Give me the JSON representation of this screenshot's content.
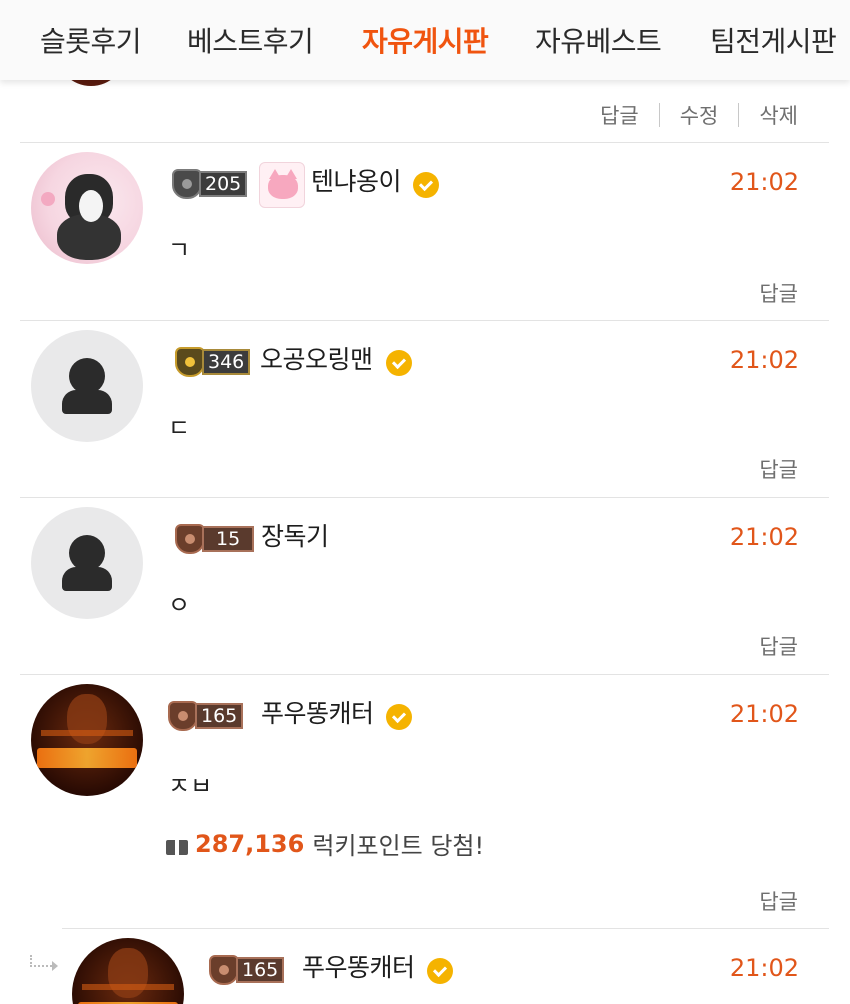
{
  "nav": {
    "tabs": [
      {
        "label": "슬롯후기",
        "active": false
      },
      {
        "label": "베스트후기",
        "active": false
      },
      {
        "label": "자유게시판",
        "active": true
      },
      {
        "label": "자유베스트",
        "active": false
      },
      {
        "label": "팀전게시판",
        "active": false
      }
    ]
  },
  "top_actions": {
    "reply": "답글",
    "edit": "수정",
    "delete": "삭제"
  },
  "comments": [
    {
      "level": "205",
      "username": "텐냐옹이",
      "time": "21:02",
      "text": "ㄱ",
      "reply": "답글"
    },
    {
      "level": "346",
      "username": "오공오링맨",
      "time": "21:02",
      "text": "ㄷ",
      "reply": "답글"
    },
    {
      "level": "15",
      "username": "장독기",
      "time": "21:02",
      "text": "ㅇ",
      "reply": "답글"
    },
    {
      "level": "165",
      "username": "푸우똥캐터",
      "time": "21:02",
      "text": "ㅈㅂ",
      "lucky_points": "287,136",
      "lucky_text": "럭키포인트 당첨!",
      "reply": "답글"
    },
    {
      "level": "165",
      "username": "푸우똥캐터",
      "time": "21:02"
    }
  ],
  "colors": {
    "accent": "#f0540f",
    "time": "#e1561a",
    "verified": "#f5b300"
  }
}
